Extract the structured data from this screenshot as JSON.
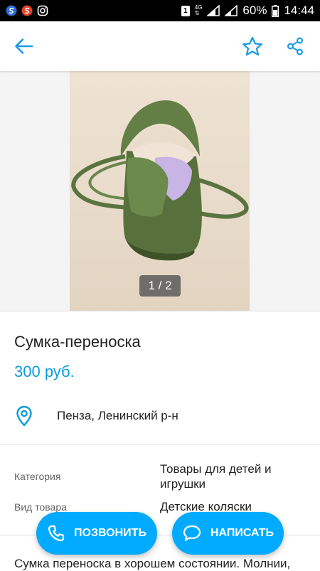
{
  "status_bar": {
    "sim_slot": "1",
    "network_type": "4G",
    "battery": "60%",
    "time": "14:44"
  },
  "app_bar": {
    "back_icon": "arrow-left-icon",
    "favorite_icon": "star-outline-icon",
    "share_icon": "share-icon",
    "accent_color": "#1a9be6"
  },
  "gallery": {
    "counter": "1 / 2",
    "current": 1,
    "total": 2
  },
  "listing": {
    "title": "Сумка-переноска",
    "price": "300 руб.",
    "price_color": "#0a9bde",
    "location": "Пенза, Ленинский р-н",
    "location_icon": "map-pin-icon"
  },
  "params": [
    {
      "label": "Категория",
      "value": "Товары для детей и игрушки"
    },
    {
      "label": "Вид товара",
      "value": "Детские коляски"
    }
  ],
  "description": "Сумка переноска в хорошем состоянии. Молнии,",
  "actions": {
    "call_label": "ПОЗВОНИТЬ",
    "call_icon": "phone-icon",
    "write_label": "НАПИСАТЬ",
    "write_icon": "chat-bubble-icon",
    "button_color": "#00aaff"
  }
}
